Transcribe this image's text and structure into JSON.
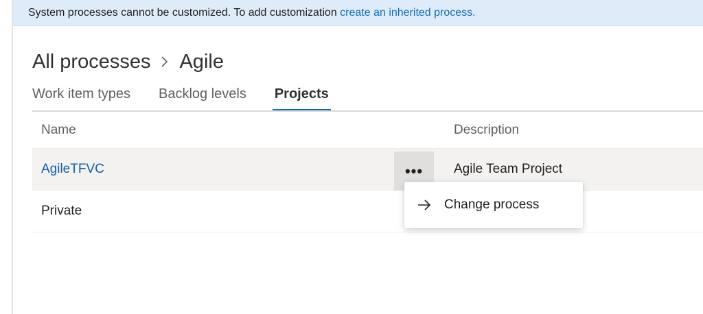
{
  "banner": {
    "text": "System processes cannot be customized. To add customization ",
    "link": "create an inherited process."
  },
  "breadcrumb": {
    "root": "All processes",
    "current": "Agile",
    "separator_icon": "chevron-right-icon"
  },
  "tabs": [
    {
      "label": "Work item types",
      "active": false
    },
    {
      "label": "Backlog levels",
      "active": false
    },
    {
      "label": "Projects",
      "active": true
    }
  ],
  "grid": {
    "columns": {
      "name": "Name",
      "description": "Description"
    },
    "rows": [
      {
        "name": "AgileTFVC",
        "description": "Agile Team Project",
        "is_link": true
      },
      {
        "name": "Private",
        "description": "",
        "is_link": false
      }
    ],
    "more_label": "•••"
  },
  "context_menu": {
    "items": [
      {
        "label": "Change process",
        "icon": "arrow-right-icon"
      }
    ]
  },
  "colors": {
    "accent": "#0f6cbd",
    "banner_bg": "#deecf9",
    "selected_row": "#f3f2f1"
  }
}
